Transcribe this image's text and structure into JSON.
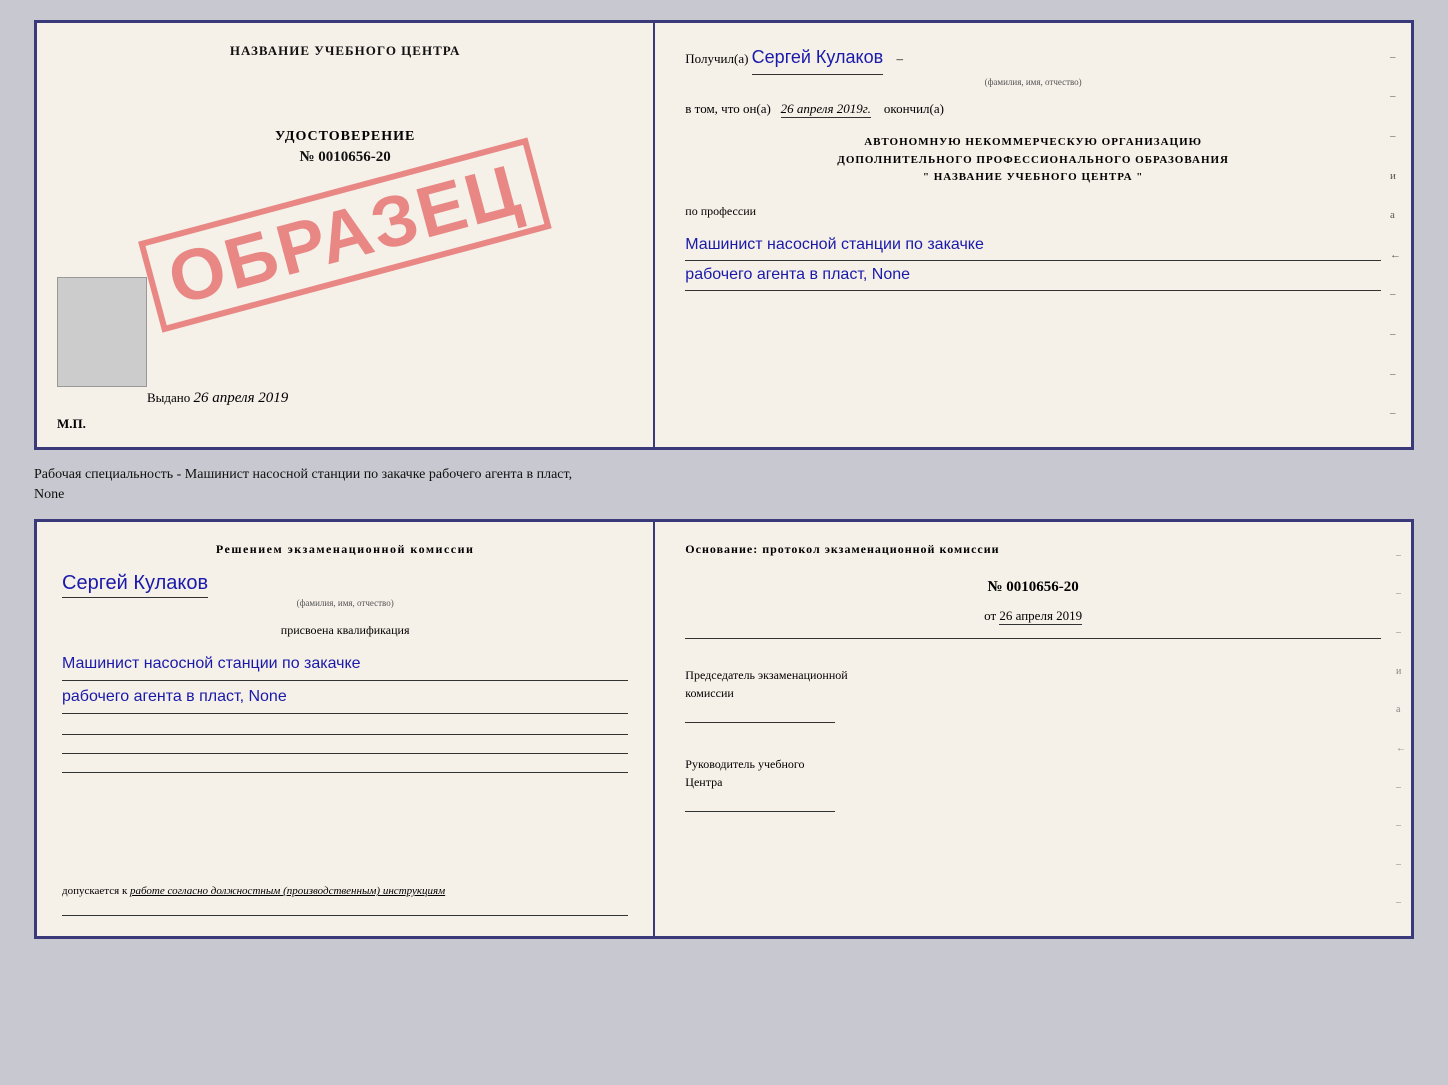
{
  "page": {
    "background_color": "#c8c8d0"
  },
  "top_cert": {
    "left": {
      "title": "НАЗВАНИЕ УЧЕБНОГО ЦЕНТРА",
      "stamp": "ОБРАЗЕЦ",
      "udostoverenie_label": "УДОСТОВЕРЕНИЕ",
      "udostoverenie_number": "№ 0010656-20",
      "vydano_label": "Выдано",
      "vydano_date": "26 апреля 2019",
      "mp_label": "М.П."
    },
    "right": {
      "poluchil_label": "Получил(а)",
      "poluchil_name": "Сергей Кулаков",
      "familiya_hint": "(фамилия, имя, отчество)",
      "vtom_label": "в том, что он(а)",
      "vtom_date": "26 апреля 2019г.",
      "okonchil_label": "окончил(а)",
      "org_line1": "АВТОНОМНУЮ НЕКОММЕРЧЕСКУЮ ОРГАНИЗАЦИЮ",
      "org_line2": "ДОПОЛНИТЕЛЬНОГО ПРОФЕССИОНАЛЬНОГО ОБРАЗОВАНИЯ",
      "org_name": "\" НАЗВАНИЕ УЧЕБНОГО ЦЕНТРА \"",
      "professiya_label": "по профессии",
      "professiya_line1": "Машинист насосной станции по закачке",
      "professiya_line2": "рабочего агента в пласт, None"
    }
  },
  "caption": {
    "text1": "Рабочая специальность - Машинист насосной станции по закачке рабочего агента в пласт,",
    "text2": "None"
  },
  "bottom_cert": {
    "left": {
      "resheniyem_text": "Решением  экзаменационной  комиссии",
      "person_name": "Сергей Кулаков",
      "familiya_hint": "(фамилия, имя, отчество)",
      "prisvoena_text": "присвоена квалификация",
      "kval_line1": "Машинист насосной станции по закачке",
      "kval_line2": "рабочего агента в пласт, None",
      "dopuskaetsya_label": "допускается к",
      "dopuskaetsya_value": "работе согласно должностным (производственным) инструкциям"
    },
    "right": {
      "osnovanie_text": "Основание:  протокол  экзаменационной  комиссии",
      "protokol_number": "№  0010656-20",
      "ot_label": "от",
      "ot_date": "26 апреля 2019",
      "predsedatel_line1": "Председатель экзаменационной",
      "predsedatel_line2": "комиссии",
      "rukovoditel_line1": "Руководитель учебного",
      "rukovoditel_line2": "Центра"
    }
  },
  "right_margin_chars": [
    "-",
    "-",
    "-",
    "и",
    "а",
    "←",
    "-",
    "-",
    "-",
    "-"
  ]
}
